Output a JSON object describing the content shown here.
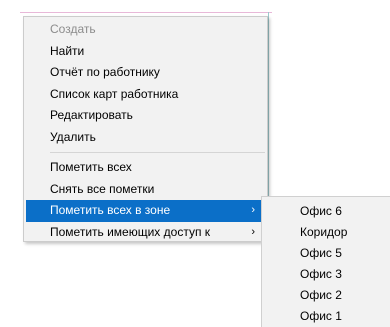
{
  "context_menu": {
    "items": [
      {
        "label": "Создать",
        "disabled": true
      },
      {
        "label": "Найти"
      },
      {
        "label": "Отчёт по работнику"
      },
      {
        "label": "Список карт работника"
      },
      {
        "label": "Редактировать"
      },
      {
        "label": "Удалить"
      }
    ],
    "items2": [
      {
        "label": "Пометить всех"
      },
      {
        "label": "Снять все пометки"
      },
      {
        "label": "Пометить всех в зоне",
        "arrow": "›"
      },
      {
        "label": "Пометить имеющих доступ к",
        "arrow": "›"
      }
    ]
  },
  "submenu": {
    "items": [
      {
        "label": "Офис 6"
      },
      {
        "label": "Коридор"
      },
      {
        "label": "Офис 5"
      },
      {
        "label": "Офис 3"
      },
      {
        "label": "Офис 2"
      },
      {
        "label": "Офис 1"
      }
    ]
  },
  "colors": {
    "highlight": "#0b6fc8",
    "menu_bg": "#f2f2f2",
    "disabled_text": "#8c8c8c"
  }
}
